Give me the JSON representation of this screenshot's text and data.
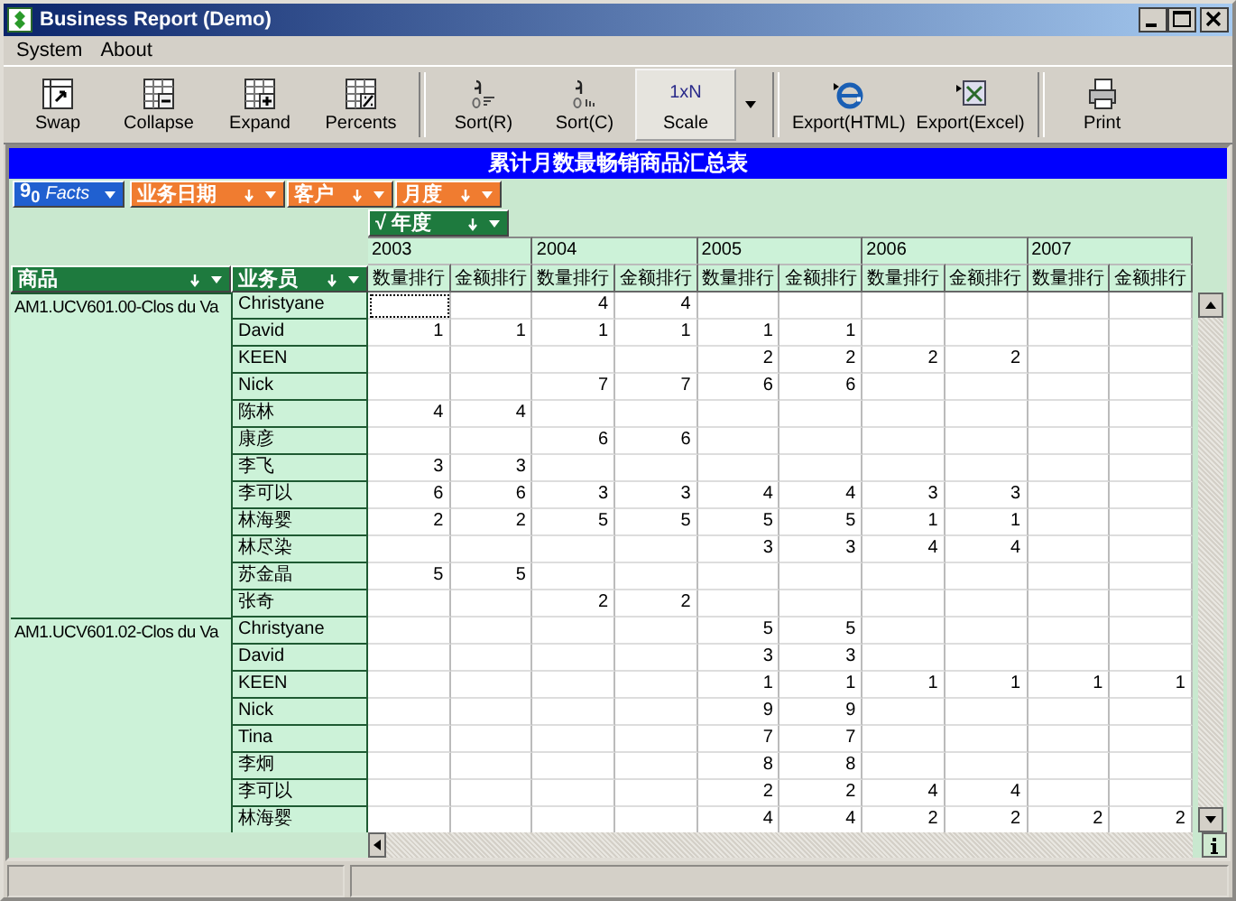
{
  "window": {
    "title": "Business Report (Demo)"
  },
  "menu": [
    "System",
    "About"
  ],
  "toolbar": [
    {
      "label": "Swap",
      "kind": "swap",
      "selected": false
    },
    {
      "label": "Collapse",
      "kind": "collapse",
      "selected": false
    },
    {
      "label": "Expand",
      "kind": "expand",
      "selected": false
    },
    {
      "label": "Percents",
      "kind": "percents",
      "selected": false
    },
    {
      "label": "Sort(R)",
      "kind": "sortr",
      "selected": false
    },
    {
      "label": "Sort(C)",
      "kind": "sortc",
      "selected": false
    },
    {
      "label": "Scale",
      "kind": "scale",
      "icon_text": "1xN",
      "selected": true
    },
    {
      "label": "Export(HTML)",
      "kind": "html",
      "selected": false
    },
    {
      "label": "Export(Excel)",
      "kind": "excel",
      "selected": false
    },
    {
      "label": "Print",
      "kind": "print",
      "selected": false
    }
  ],
  "report_title": "累计月数最畅销商品汇总表",
  "facts": {
    "badge": "9$_{0}$",
    "label": "Facts"
  },
  "filter_fields": [
    "业务日期",
    "客户",
    "月度"
  ],
  "column_field": {
    "mark": "√",
    "label": "年度"
  },
  "row_fields": [
    "商品",
    "业务员"
  ],
  "years": [
    {
      "year": "2003",
      "measures": [
        "数量排行",
        "金额排行"
      ]
    },
    {
      "year": "2004",
      "measures": [
        "数量排行",
        "金额排行"
      ]
    },
    {
      "year": "2005",
      "measures": [
        "数量排行",
        "金额排行"
      ]
    },
    {
      "year": "2006",
      "measures": [
        "数量排行",
        "金额排行"
      ]
    },
    {
      "year": "2007",
      "measures": [
        "数量排行",
        "金额排行"
      ]
    }
  ],
  "groups": [
    {
      "product": "AM1.UCV601.00-Clos du Va",
      "rows": [
        {
          "name": "Christyane",
          "cells": [
            null,
            null,
            "4",
            "4",
            null,
            null,
            null,
            null,
            null,
            null
          ]
        },
        {
          "name": "David",
          "cells": [
            "1",
            "1",
            "1",
            "1",
            "1",
            "1",
            null,
            null,
            null,
            null
          ]
        },
        {
          "name": "KEEN",
          "cells": [
            null,
            null,
            null,
            null,
            "2",
            "2",
            "2",
            "2",
            null,
            null
          ]
        },
        {
          "name": "Nick",
          "cells": [
            null,
            null,
            "7",
            "7",
            "6",
            "6",
            null,
            null,
            null,
            null
          ]
        },
        {
          "name": "陈林",
          "cells": [
            "4",
            "4",
            null,
            null,
            null,
            null,
            null,
            null,
            null,
            null
          ]
        },
        {
          "name": "康彦",
          "cells": [
            null,
            null,
            "6",
            "6",
            null,
            null,
            null,
            null,
            null,
            null
          ]
        },
        {
          "name": "李飞",
          "cells": [
            "3",
            "3",
            null,
            null,
            null,
            null,
            null,
            null,
            null,
            null
          ]
        },
        {
          "name": "李可以",
          "cells": [
            "6",
            "6",
            "3",
            "3",
            "4",
            "4",
            "3",
            "3",
            null,
            null
          ]
        },
        {
          "name": "林海婴",
          "cells": [
            "2",
            "2",
            "5",
            "5",
            "5",
            "5",
            "1",
            "1",
            null,
            null
          ]
        },
        {
          "name": "林尽染",
          "cells": [
            null,
            null,
            null,
            null,
            "3",
            "3",
            "4",
            "4",
            null,
            null
          ]
        },
        {
          "name": "苏金晶",
          "cells": [
            "5",
            "5",
            null,
            null,
            null,
            null,
            null,
            null,
            null,
            null
          ]
        },
        {
          "name": "张奇",
          "cells": [
            null,
            null,
            "2",
            "2",
            null,
            null,
            null,
            null,
            null,
            null
          ]
        }
      ]
    },
    {
      "product": "AM1.UCV601.02-Clos du Va",
      "rows": [
        {
          "name": "Christyane",
          "cells": [
            null,
            null,
            null,
            null,
            "5",
            "5",
            null,
            null,
            null,
            null
          ]
        },
        {
          "name": "David",
          "cells": [
            null,
            null,
            null,
            null,
            "3",
            "3",
            null,
            null,
            null,
            null
          ]
        },
        {
          "name": "KEEN",
          "cells": [
            null,
            null,
            null,
            null,
            "1",
            "1",
            "1",
            "1",
            "1",
            "1"
          ]
        },
        {
          "name": "Nick",
          "cells": [
            null,
            null,
            null,
            null,
            "9",
            "9",
            null,
            null,
            null,
            null
          ]
        },
        {
          "name": "Tina",
          "cells": [
            null,
            null,
            null,
            null,
            "7",
            "7",
            null,
            null,
            null,
            null
          ]
        },
        {
          "name": "李炯",
          "cells": [
            null,
            null,
            null,
            null,
            "8",
            "8",
            null,
            null,
            null,
            null
          ]
        },
        {
          "name": "李可以",
          "cells": [
            null,
            null,
            null,
            null,
            "2",
            "2",
            "4",
            "4",
            null,
            null
          ]
        },
        {
          "name": "林海婴",
          "cells": [
            null,
            null,
            null,
            null,
            "4",
            "4",
            "2",
            "2",
            "2",
            "2"
          ]
        }
      ]
    }
  ]
}
